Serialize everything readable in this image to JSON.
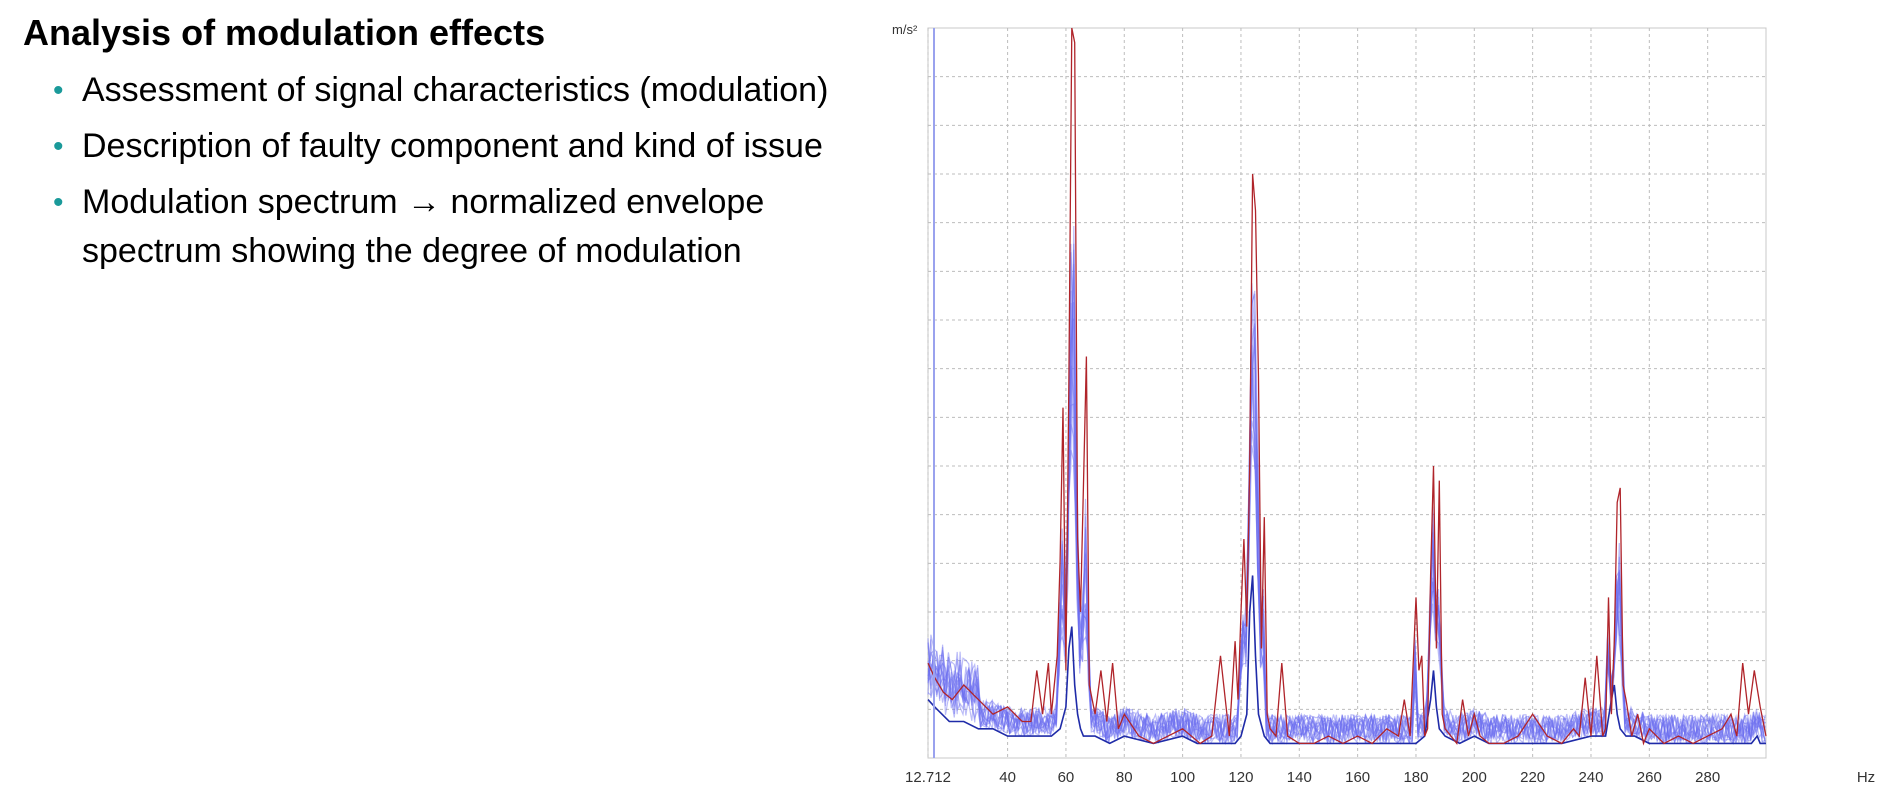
{
  "slide": {
    "title": "Analysis of modulation effects",
    "bullets": [
      "Assessment of signal characteristics (modulation)",
      "Description of faulty component and kind of issue",
      "Modulation spectrum → normalized envelope spectrum showing the degree of modulation"
    ]
  },
  "chart_data": {
    "type": "line",
    "ylabel": "m/s²",
    "xlabel": "Hz",
    "xlim": [
      12.712,
      300
    ],
    "ylim": [
      0,
      100
    ],
    "x_ticks": [
      12.712,
      40,
      60,
      80,
      100,
      120,
      140,
      160,
      180,
      200,
      220,
      240,
      260,
      280
    ],
    "x_tick_labels": [
      "12.712",
      "40",
      "60",
      "80",
      "100",
      "120",
      "140",
      "160",
      "180",
      "200",
      "220",
      "240",
      "260",
      "280"
    ],
    "grid": true,
    "colors": {
      "red_series": "#b0242a",
      "blue_band": "#6a6df0",
      "dark_blue": "#1f2ba8",
      "grid": "#bdbdbd"
    },
    "series": [
      {
        "color": "#b0242a",
        "x": [
          12.7,
          15,
          18,
          21,
          25,
          30,
          35,
          40,
          45,
          48,
          50,
          52,
          54,
          55,
          56,
          57,
          58,
          59,
          60,
          61,
          62,
          63,
          64,
          65,
          66,
          67,
          68,
          70,
          72,
          74,
          76,
          78,
          80,
          85,
          90,
          95,
          100,
          103,
          106,
          110,
          113,
          116,
          118,
          119,
          120,
          121,
          122,
          123,
          124,
          125,
          126,
          127,
          128,
          129,
          130,
          132,
          134,
          136,
          140,
          145,
          150,
          155,
          160,
          165,
          170,
          174,
          176,
          178,
          180,
          181,
          182,
          183,
          184,
          185,
          186,
          187,
          188,
          189,
          190,
          192,
          194,
          196,
          198,
          200,
          202,
          205,
          210,
          215,
          220,
          225,
          230,
          234,
          236,
          238,
          240,
          242,
          244,
          245,
          246,
          247,
          248,
          249,
          250,
          251,
          252,
          254,
          256,
          258,
          260,
          265,
          270,
          275,
          280,
          285,
          288,
          290,
          292,
          294,
          296,
          298,
          300
        ],
        "values": [
          13,
          11,
          9,
          8,
          10,
          8,
          6,
          7,
          5,
          5,
          12,
          6,
          13,
          6,
          10,
          14,
          27,
          48,
          12,
          52,
          100,
          98,
          30,
          20,
          37,
          55,
          10,
          6,
          12,
          5,
          13,
          4,
          6,
          3,
          2,
          3,
          4,
          3,
          2,
          3,
          14,
          3,
          16,
          8,
          20,
          30,
          18,
          40,
          80,
          75,
          52,
          15,
          33,
          6,
          4,
          3,
          13,
          3,
          2,
          2,
          3,
          2,
          3,
          2,
          4,
          3,
          8,
          3,
          22,
          12,
          14,
          3,
          4,
          25,
          40,
          15,
          38,
          6,
          4,
          3,
          2,
          8,
          3,
          6,
          3,
          2,
          2,
          3,
          6,
          3,
          2,
          4,
          3,
          11,
          3,
          14,
          3,
          4,
          22,
          6,
          16,
          35,
          37,
          10,
          8,
          3,
          6,
          2,
          4,
          2,
          3,
          2,
          3,
          4,
          6,
          3,
          13,
          6,
          12,
          7,
          3
        ]
      },
      {
        "color": "#1f2ba8",
        "x": [
          12.7,
          15,
          20,
          25,
          30,
          35,
          40,
          45,
          50,
          55,
          58,
          60,
          61,
          62,
          63,
          64,
          65,
          66,
          70,
          75,
          80,
          90,
          100,
          105,
          110,
          115,
          118,
          120,
          122,
          123,
          124,
          125,
          126,
          128,
          130,
          135,
          140,
          150,
          160,
          170,
          180,
          183,
          185,
          186,
          187,
          188,
          190,
          195,
          200,
          205,
          210,
          220,
          230,
          240,
          245,
          247,
          248,
          249,
          250,
          252,
          255,
          260,
          270,
          280,
          290,
          295,
          297,
          298,
          300
        ],
        "values": [
          8,
          7,
          5,
          5,
          4,
          4,
          3,
          3,
          3,
          3,
          4,
          7,
          15,
          18,
          10,
          6,
          4,
          3,
          3,
          2,
          3,
          2,
          3,
          2,
          2,
          2,
          2,
          3,
          6,
          20,
          25,
          14,
          6,
          3,
          2,
          2,
          2,
          2,
          2,
          2,
          2,
          3,
          8,
          12,
          7,
          4,
          3,
          2,
          3,
          2,
          2,
          2,
          2,
          3,
          3,
          8,
          10,
          6,
          4,
          3,
          3,
          2,
          2,
          2,
          2,
          2,
          3,
          2,
          2
        ]
      }
    ]
  }
}
